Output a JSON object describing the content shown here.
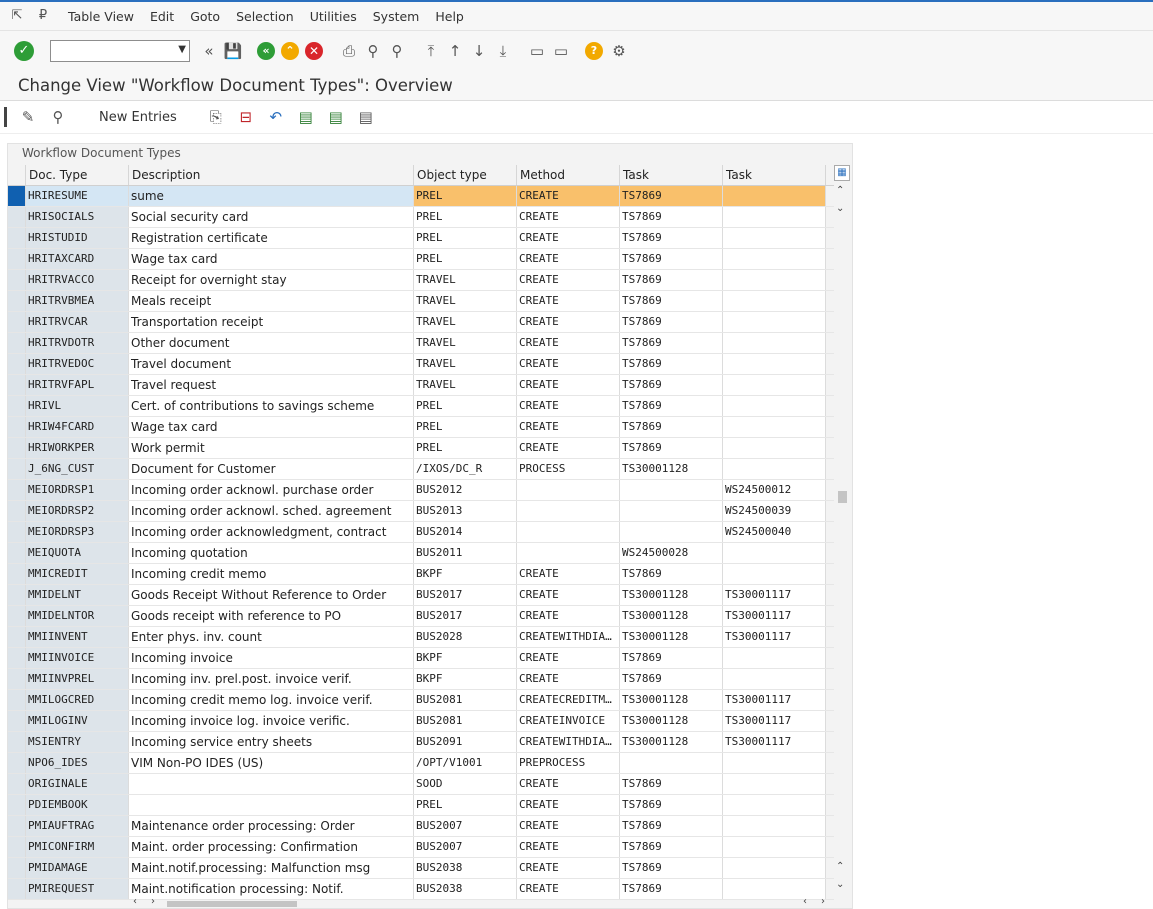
{
  "menu": [
    "Table View",
    "Edit",
    "Goto",
    "Selection",
    "Utilities",
    "System",
    "Help"
  ],
  "command_field": {
    "value": ""
  },
  "title": "Change View \"Workflow Document Types\": Overview",
  "app_toolbar": {
    "new_entries": "New Entries"
  },
  "panel_title": "Workflow Document Types",
  "columns": [
    "Doc. Type",
    "Description",
    "Object type",
    "Method",
    "Task",
    "Task"
  ],
  "rows": [
    {
      "doc": "HRIRESUME",
      "desc": "sume",
      "obj": "PREL",
      "meth": "CREATE",
      "t1": "TS7869",
      "t2": ""
    },
    {
      "doc": "HRISOCIALS",
      "desc": "Social security card",
      "obj": "PREL",
      "meth": "CREATE",
      "t1": "TS7869",
      "t2": ""
    },
    {
      "doc": "HRISTUDID",
      "desc": "Registration certificate",
      "obj": "PREL",
      "meth": "CREATE",
      "t1": "TS7869",
      "t2": ""
    },
    {
      "doc": "HRITAXCARD",
      "desc": "Wage tax card",
      "obj": "PREL",
      "meth": "CREATE",
      "t1": "TS7869",
      "t2": ""
    },
    {
      "doc": "HRITRVACCO",
      "desc": "Receipt for overnight stay",
      "obj": "TRAVEL",
      "meth": "CREATE",
      "t1": "TS7869",
      "t2": ""
    },
    {
      "doc": "HRITRVBMEA",
      "desc": "Meals receipt",
      "obj": "TRAVEL",
      "meth": "CREATE",
      "t1": "TS7869",
      "t2": ""
    },
    {
      "doc": "HRITRVCAR",
      "desc": "Transportation receipt",
      "obj": "TRAVEL",
      "meth": "CREATE",
      "t1": "TS7869",
      "t2": ""
    },
    {
      "doc": "HRITRVDOTR",
      "desc": "Other document",
      "obj": "TRAVEL",
      "meth": "CREATE",
      "t1": "TS7869",
      "t2": ""
    },
    {
      "doc": "HRITRVEDOC",
      "desc": "Travel document",
      "obj": "TRAVEL",
      "meth": "CREATE",
      "t1": "TS7869",
      "t2": ""
    },
    {
      "doc": "HRITRVFAPL",
      "desc": "Travel request",
      "obj": "TRAVEL",
      "meth": "CREATE",
      "t1": "TS7869",
      "t2": ""
    },
    {
      "doc": "HRIVL",
      "desc": "Cert. of contributions to savings scheme",
      "obj": "PREL",
      "meth": "CREATE",
      "t1": "TS7869",
      "t2": ""
    },
    {
      "doc": "HRIW4FCARD",
      "desc": "Wage tax card",
      "obj": "PREL",
      "meth": "CREATE",
      "t1": "TS7869",
      "t2": ""
    },
    {
      "doc": "HRIWORKPER",
      "desc": "Work permit",
      "obj": "PREL",
      "meth": "CREATE",
      "t1": "TS7869",
      "t2": ""
    },
    {
      "doc": "J_6NG_CUST",
      "desc": "Document for Customer",
      "obj": "/IXOS/DC_R",
      "meth": "PROCESS",
      "t1": "TS30001128",
      "t2": ""
    },
    {
      "doc": "MEIORDRSP1",
      "desc": "Incoming order acknowl. purchase order",
      "obj": "BUS2012",
      "meth": "",
      "t1": "",
      "t2": "WS24500012"
    },
    {
      "doc": "MEIORDRSP2",
      "desc": "Incoming order acknowl. sched. agreement",
      "obj": "BUS2013",
      "meth": "",
      "t1": "",
      "t2": "WS24500039"
    },
    {
      "doc": "MEIORDRSP3",
      "desc": "Incoming order acknowledgment, contract",
      "obj": "BUS2014",
      "meth": "",
      "t1": "",
      "t2": "WS24500040"
    },
    {
      "doc": "MEIQUOTA",
      "desc": "Incoming quotation",
      "obj": "BUS2011",
      "meth": "",
      "t1": "WS24500028",
      "t2": ""
    },
    {
      "doc": "MMICREDIT",
      "desc": "Incoming credit memo",
      "obj": "BKPF",
      "meth": "CREATE",
      "t1": "TS7869",
      "t2": ""
    },
    {
      "doc": "MMIDELNT",
      "desc": "Goods Receipt Without Reference to Order",
      "obj": "BUS2017",
      "meth": "CREATE",
      "t1": "TS30001128",
      "t2": "TS30001117"
    },
    {
      "doc": "MMIDELNTOR",
      "desc": "Goods receipt with reference to PO",
      "obj": "BUS2017",
      "meth": "CREATE",
      "t1": "TS30001128",
      "t2": "TS30001117"
    },
    {
      "doc": "MMIINVENT",
      "desc": "Enter phys. inv. count",
      "obj": "BUS2028",
      "meth": "CREATEWITHDIA…",
      "t1": "TS30001128",
      "t2": "TS30001117"
    },
    {
      "doc": "MMIINVOICE",
      "desc": "Incoming invoice",
      "obj": "BKPF",
      "meth": "CREATE",
      "t1": "TS7869",
      "t2": ""
    },
    {
      "doc": "MMIINVPREL",
      "desc": "Incoming inv. prel.post. invoice verif.",
      "obj": "BKPF",
      "meth": "CREATE",
      "t1": "TS7869",
      "t2": ""
    },
    {
      "doc": "MMILOGCRED",
      "desc": "Incoming credit memo log. invoice verif.",
      "obj": "BUS2081",
      "meth": "CREATECREDITM…",
      "t1": "TS30001128",
      "t2": "TS30001117"
    },
    {
      "doc": "MMILOGINV",
      "desc": "Incoming invoice log. invoice verific.",
      "obj": "BUS2081",
      "meth": "CREATEINVOICE",
      "t1": "TS30001128",
      "t2": "TS30001117"
    },
    {
      "doc": "MSIENTRY",
      "desc": "Incoming service entry sheets",
      "obj": "BUS2091",
      "meth": "CREATEWITHDIA…",
      "t1": "TS30001128",
      "t2": "TS30001117"
    },
    {
      "doc": "NPO6_IDES",
      "desc": "VIM Non-PO IDES (US)",
      "obj": "/OPT/V1001",
      "meth": "PREPROCESS",
      "t1": "",
      "t2": ""
    },
    {
      "doc": "ORIGINALE",
      "desc": "",
      "obj": "SOOD",
      "meth": "CREATE",
      "t1": "TS7869",
      "t2": ""
    },
    {
      "doc": "PDIEMBOOK",
      "desc": "",
      "obj": "PREL",
      "meth": "CREATE",
      "t1": "TS7869",
      "t2": ""
    },
    {
      "doc": "PMIAUFTRAG",
      "desc": "Maintenance order processing: Order",
      "obj": "BUS2007",
      "meth": "CREATE",
      "t1": "TS7869",
      "t2": ""
    },
    {
      "doc": "PMICONFIRM",
      "desc": "Maint. order processing: Confirmation",
      "obj": "BUS2007",
      "meth": "CREATE",
      "t1": "TS7869",
      "t2": ""
    },
    {
      "doc": "PMIDAMAGE",
      "desc": "Maint.notif.processing: Malfunction msg",
      "obj": "BUS2038",
      "meth": "CREATE",
      "t1": "TS7869",
      "t2": ""
    },
    {
      "doc": "PMIREQUEST",
      "desc": "Maint.notification processing: Notif.",
      "obj": "BUS2038",
      "meth": "CREATE",
      "t1": "TS7869",
      "t2": ""
    }
  ]
}
